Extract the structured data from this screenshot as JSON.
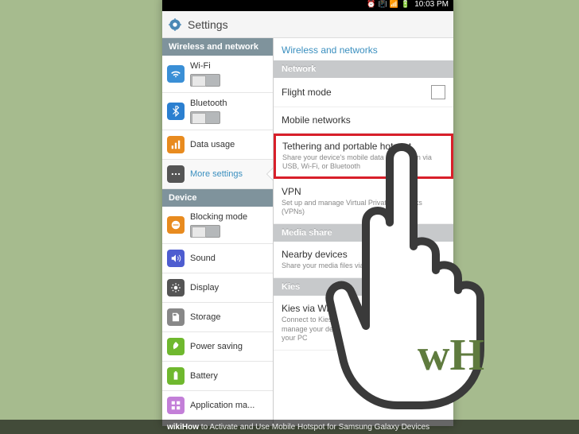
{
  "statusbar": {
    "time": "10:03 PM"
  },
  "header": {
    "title": "Settings"
  },
  "sidebar": {
    "cat1": "Wireless and network",
    "cat2": "Device",
    "items": {
      "wifi": "Wi-Fi",
      "bluetooth": "Bluetooth",
      "datausage": "Data usage",
      "more": "More settings",
      "blocking": "Blocking mode",
      "sound": "Sound",
      "display": "Display",
      "storage": "Storage",
      "power": "Power saving",
      "battery": "Battery",
      "appmgr": "Application ma..."
    }
  },
  "main": {
    "title": "Wireless and networks",
    "sections": {
      "network": "Network",
      "media": "Media share",
      "kies": "Kies"
    },
    "rows": {
      "flight": {
        "title": "Flight mode"
      },
      "mobile": {
        "title": "Mobile networks"
      },
      "tether": {
        "title": "Tethering and portable hotspot",
        "sub": "Share your device's mobile data connection via USB, Wi-Fi, or Bluetooth"
      },
      "vpn": {
        "title": "VPN",
        "sub": "Set up and manage Virtual Private Networks (VPNs)"
      },
      "nearby": {
        "title": "Nearby devices",
        "sub": "Share your media files via DLNA"
      },
      "kieswifi": {
        "title": "Kies via Wi-Fi",
        "sub": "Connect to Kies on your PC via Wi-Fi network to manage your device data and synchronize it with your PC"
      }
    }
  },
  "caption": {
    "prefix": "wikiHow",
    "text": " to Activate and Use Mobile Hotspot for Samsung Galaxy Devices"
  },
  "watermark": "wH"
}
